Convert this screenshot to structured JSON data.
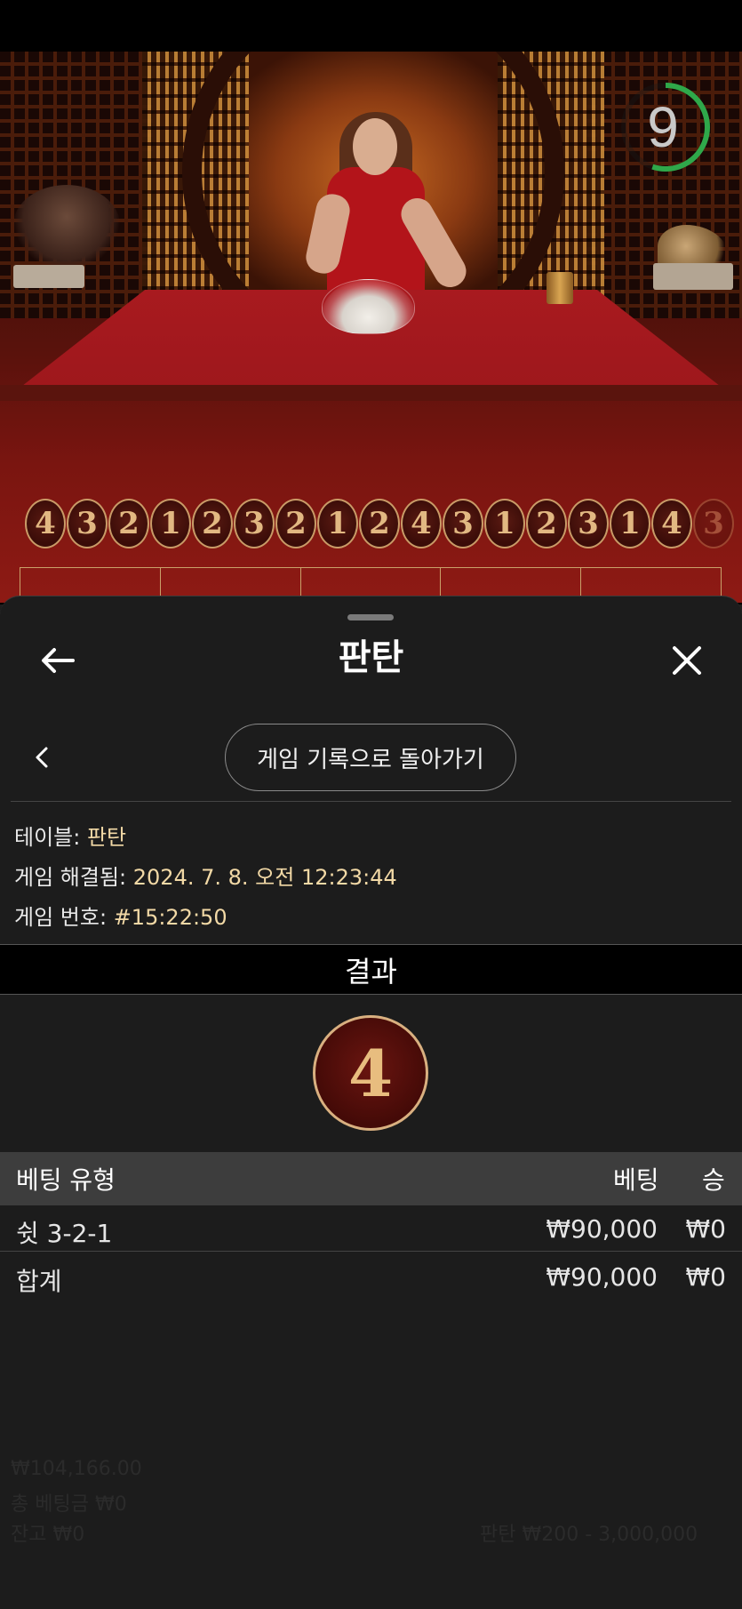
{
  "timer": {
    "value": "9",
    "ring_color": "#2fa84a",
    "fraction_remaining": 0.55
  },
  "road": {
    "results": [
      "4",
      "3",
      "2",
      "1",
      "2",
      "3",
      "2",
      "1",
      "2",
      "4",
      "3",
      "1",
      "2",
      "3",
      "1",
      "4",
      "3"
    ]
  },
  "sheet": {
    "title": "판탄",
    "back_icon": "arrow-left-icon",
    "close_icon": "close-icon",
    "history_button": "게임 기록으로 돌아가기",
    "info": {
      "table_label": "테이블:",
      "table_value": "판탄",
      "resolved_label": "게임 해결됨:",
      "resolved_value": "2024. 7. 8. 오전 12:23:44",
      "number_label": "게임 번호:",
      "number_value": "#15:22:50"
    },
    "result_header": "결과",
    "result_value": "4",
    "columns": {
      "type": "베팅 유형",
      "bet": "베팅",
      "win": "승"
    },
    "rows": [
      {
        "type": "쉿 3-2-1",
        "bet": "₩90,000",
        "win": "₩0"
      }
    ],
    "total": {
      "label": "합계",
      "bet": "₩90,000",
      "win": "₩0"
    }
  },
  "underlay": {
    "balance": "₩104,166.00",
    "total_bet": "총 베팅금 ₩0",
    "last_win": "잔고 ₩0",
    "limits": "판탄 ₩200 - 3,000,000"
  },
  "colors": {
    "accent_gold": "#d9b080",
    "sheet_bg": "#1c1c1c",
    "table_red": "#a81a1f"
  }
}
